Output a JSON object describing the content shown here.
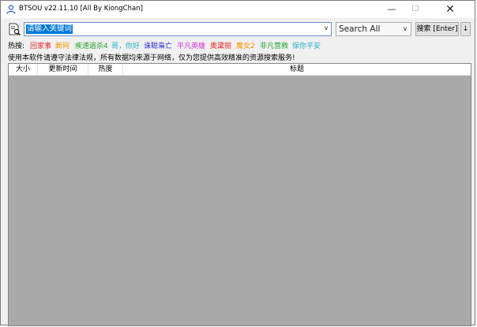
{
  "window": {
    "title": "BTSOU v22.11.10 [All By KiongChan]",
    "controls": {
      "minimize": "—",
      "maximize": "☐",
      "close": "✕"
    }
  },
  "search": {
    "input_value": "请输入关键词",
    "scope_selected": "Search All",
    "search_button_label": "搜索 [Enter]",
    "sort_button_label": "↓"
  },
  "hot": {
    "label": "热搜:",
    "items": [
      {
        "text": "回家事",
        "color": "#e8262b"
      },
      {
        "text": "断网",
        "color": "#f39800"
      },
      {
        "text": "疾速追杀4",
        "color": "#26a22b"
      },
      {
        "text": "哥，你好",
        "color": "#26b0c9"
      },
      {
        "text": "诛聪枭亡",
        "color": "#2b2bd9"
      },
      {
        "text": "平凡英雄",
        "color": "#d92bd9"
      },
      {
        "text": "奥黛丽",
        "color": "#e8262b"
      },
      {
        "text": "魔女2",
        "color": "#f39800"
      },
      {
        "text": "非凡营救",
        "color": "#26a22b"
      },
      {
        "text": "保你平安",
        "color": "#26b0c9"
      }
    ]
  },
  "notice": "使用本软件请遵守法律法规，所有数据均来源于网络，仅为您提供高效精准的资源搜索服务!",
  "table": {
    "columns": [
      "大小",
      "更新时间",
      "热度",
      "标题"
    ],
    "rows": []
  },
  "colors": {
    "accent": "#0078d7",
    "list_background": "#a9a9a9"
  }
}
